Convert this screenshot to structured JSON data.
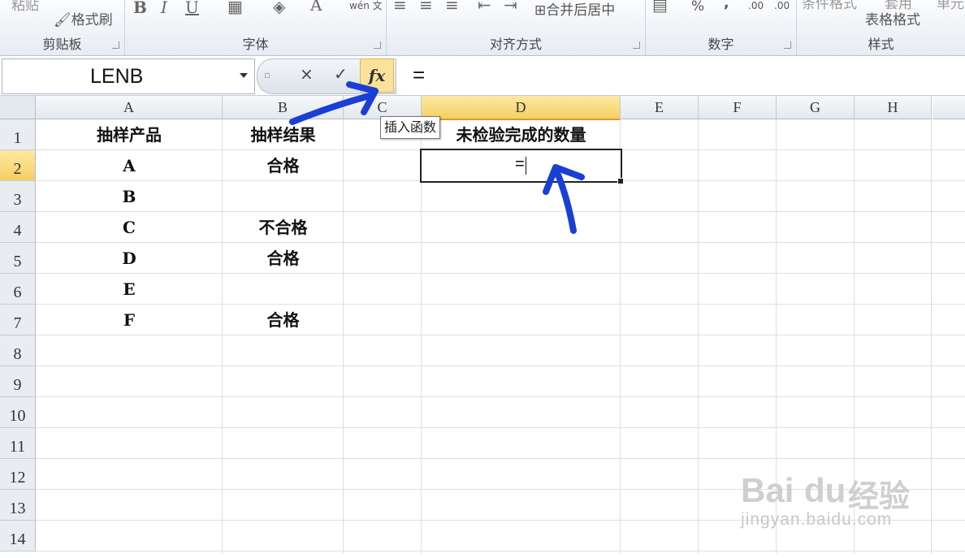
{
  "ribbon": {
    "clipboard": {
      "paste": "粘贴",
      "format_painter": "格式刷",
      "label": "剪贴板"
    },
    "font": {
      "bold": "B",
      "italic": "I",
      "underline": "U",
      "font_color": "A",
      "wen": "wén 文",
      "label": "字体"
    },
    "alignment": {
      "merge_center": "合并后居中",
      "label": "对齐方式"
    },
    "number": {
      "percent": "%",
      "comma": ",",
      "inc_decimal": ".00",
      "dec_decimal": ".00",
      "label": "数字"
    },
    "styles": {
      "conditional": "条件格式",
      "table_format_top": "套用",
      "table_format": "表格格式",
      "cell_styles": "单元",
      "label": "样式"
    }
  },
  "formula_bar": {
    "name_box": "LENB",
    "cancel": "×",
    "enter": "✓",
    "fx": "fx",
    "formula": "="
  },
  "tooltip": "插入函数",
  "columns": [
    "A",
    "B",
    "C",
    "D",
    "E",
    "F",
    "G",
    "H"
  ],
  "rows": [
    "1",
    "2",
    "3",
    "4",
    "5",
    "6",
    "7",
    "8",
    "9",
    "10",
    "11",
    "12",
    "13",
    "14"
  ],
  "cells": {
    "A1": "抽样产品",
    "B1": "抽样结果",
    "D1": "未检验完成的数量",
    "A2": "A",
    "B2": "合格",
    "D2": "=",
    "A3": "B",
    "A4": "C",
    "B4": "不合格",
    "A5": "D",
    "B5": "合格",
    "A6": "E",
    "A7": "F",
    "B7": "合格"
  },
  "watermark": {
    "logo": "Bai",
    "du": "du",
    "cn": "经验",
    "url": "jingyan.baidu.com"
  },
  "colors": {
    "accent": "#f5cf63",
    "annotation": "#1a3fd6"
  }
}
